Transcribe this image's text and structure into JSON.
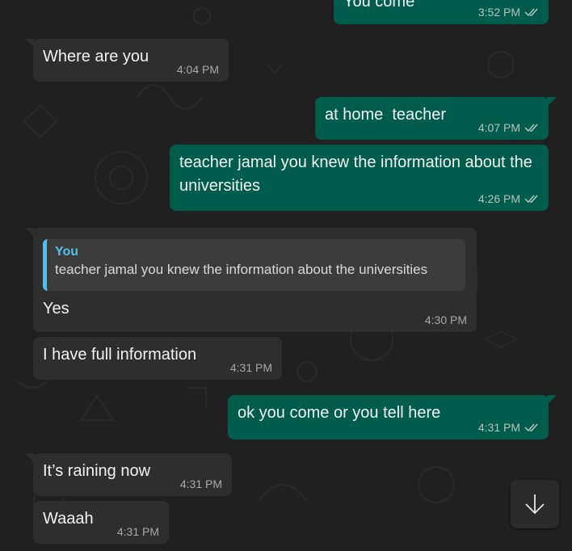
{
  "messages": [
    {
      "text": "You come",
      "time": "3:52 PM"
    },
    {
      "text": "Where are you",
      "time": "4:04 PM"
    },
    {
      "text": "at home  teacher",
      "time": "4:07 PM"
    },
    {
      "text": "teacher jamal you knew the information about the universities",
      "time": "4:26 PM"
    },
    {
      "text": "Yes",
      "time": "4:30 PM",
      "quote": {
        "author": "You",
        "text": "teacher jamal you knew the information about the universities"
      }
    },
    {
      "text": "I have full information",
      "time": "4:31 PM"
    },
    {
      "text": "ok you come or you tell here",
      "time": "4:31 PM"
    },
    {
      "text": "It’s raining now",
      "time": "4:31 PM"
    },
    {
      "text": "Waaah",
      "time": "4:31 PM"
    }
  ],
  "icons": {
    "read_receipt": "double-check-icon",
    "scroll_down": "arrow-down-icon"
  },
  "colors": {
    "background": "#202020",
    "incoming_bubble": "#2e2e2e",
    "outgoing_bubble": "#005c4b",
    "quote_accent": "#53bdeb"
  }
}
